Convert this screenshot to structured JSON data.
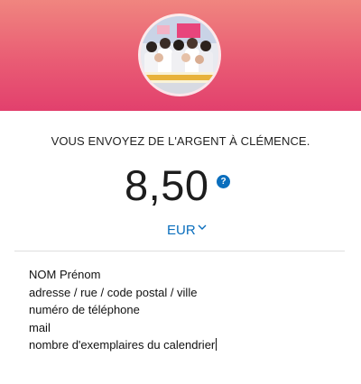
{
  "header": {
    "avatar_icon": "group-photo-avatar",
    "colors": {
      "banner_top": "#f0857f",
      "banner_bottom": "#e2406d"
    }
  },
  "payment": {
    "recipient_text": "VOUS ENVOYEZ DE L'ARGENT À CLÉMENCE.",
    "amount": "8,50",
    "help_icon_label": "?",
    "currency": "EUR",
    "accent_color": "#0a6ebd"
  },
  "note": {
    "lines": [
      "NOM Prénom",
      "adresse / rue / code postal / ville",
      "numéro de téléphone",
      "mail",
      "nombre d'exemplaires du calendrier"
    ]
  }
}
